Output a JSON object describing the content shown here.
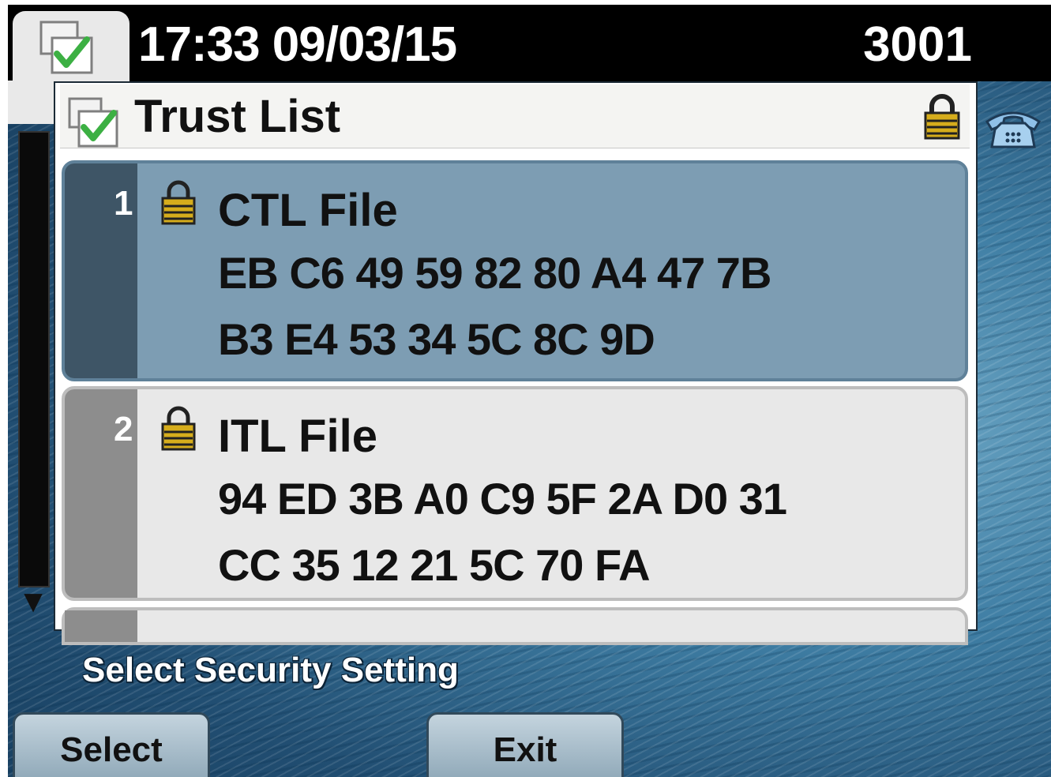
{
  "status_bar": {
    "time_date": "17:33 09/03/15",
    "line_number": "3001",
    "app_icon": "checklist-icon"
  },
  "panel": {
    "title": "Trust List",
    "title_icon": "checklist-icon",
    "lock_icon": "padlock-icon"
  },
  "entries": [
    {
      "number": "1",
      "name": "CTL File",
      "hash_line_1": "EB C6 49 59 82 80 A4 47 7B",
      "hash_line_2": "B3 E4 53 34 5C 8C 9D",
      "icon": "padlock-icon",
      "selected": true
    },
    {
      "number": "2",
      "name": "ITL File",
      "hash_line_1": "94 ED 3B A0 C9 5F 2A D0 31",
      "hash_line_2": "CC 35 12 21 5C 70 FA",
      "icon": "padlock-icon",
      "selected": false
    }
  ],
  "prompt": "Select Security Setting",
  "softkeys": {
    "select_label": "Select",
    "exit_label": "Exit"
  },
  "side_icons": {
    "phone": "phone-icon",
    "scroll_down": "▼"
  },
  "colors": {
    "selected_row": "#7d9db3",
    "selected_stripe": "#3e5566",
    "unselected_row": "#e8e8e8",
    "unselected_stripe": "#8d8d8d",
    "lock_gold": "#c9a21a",
    "check_green": "#3cb043"
  }
}
